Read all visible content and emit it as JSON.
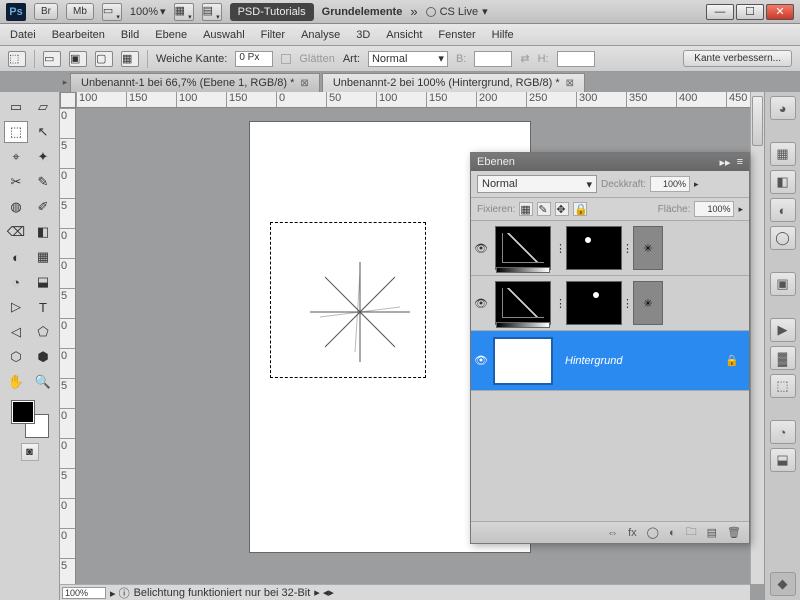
{
  "titlebar": {
    "br": "Br",
    "mb": "Mb",
    "zoom": "100%",
    "psd_tutorials": "PSD-Tutorials",
    "grundelemente": "Grundelemente",
    "chev": "»",
    "cslive": "CS Live"
  },
  "menu": {
    "datei": "Datei",
    "bearbeiten": "Bearbeiten",
    "bild": "Bild",
    "ebene": "Ebene",
    "auswahl": "Auswahl",
    "filter": "Filter",
    "analyse": "Analyse",
    "dd": "3D",
    "ansicht": "Ansicht",
    "fenster": "Fenster",
    "hilfe": "Hilfe"
  },
  "opt": {
    "weiche": "Weiche Kante:",
    "px": "0 Px",
    "glaetten": "Glätten",
    "art": "Art:",
    "art_val": "Normal",
    "b": "B:",
    "h": "H:",
    "refine": "Kante verbessern..."
  },
  "tabs": {
    "t1": "Unbenannt-1 bei 66,7% (Ebene 1, RGB/8) *",
    "t2": "Unbenannt-2 bei 100% (Hintergrund, RGB/8) *"
  },
  "ruler_h": [
    "100",
    "150",
    "100",
    "150",
    "0",
    "50",
    "100",
    "150",
    "200",
    "250",
    "300",
    "350",
    "400",
    "450"
  ],
  "ruler_v": [
    "0",
    "5",
    "0",
    "5",
    "0",
    "0",
    "5",
    "0",
    "0",
    "5",
    "0",
    "0",
    "5",
    "0",
    "0",
    "5"
  ],
  "layers": {
    "title": "Ebenen",
    "mode": "Normal",
    "opacity_lbl": "Deckkraft:",
    "opacity": "100%",
    "lock_lbl": "Fixieren:",
    "fill_lbl": "Fläche:",
    "fill": "100%",
    "bg": "Hintergrund"
  },
  "status": {
    "zoom": "100%",
    "msg": "Belichtung funktioniert nur bei 32-Bit"
  },
  "tools": [
    "▭",
    "▱",
    "⬚",
    "↖",
    "⌖",
    "✦",
    "✂",
    "✎",
    "◍",
    "✐",
    "⌫",
    "◧",
    "◐",
    "▦",
    "◔",
    "⬓",
    "▷",
    "T",
    "◁",
    "⬠",
    "⬡",
    "⬢",
    "✋",
    "🔍"
  ]
}
